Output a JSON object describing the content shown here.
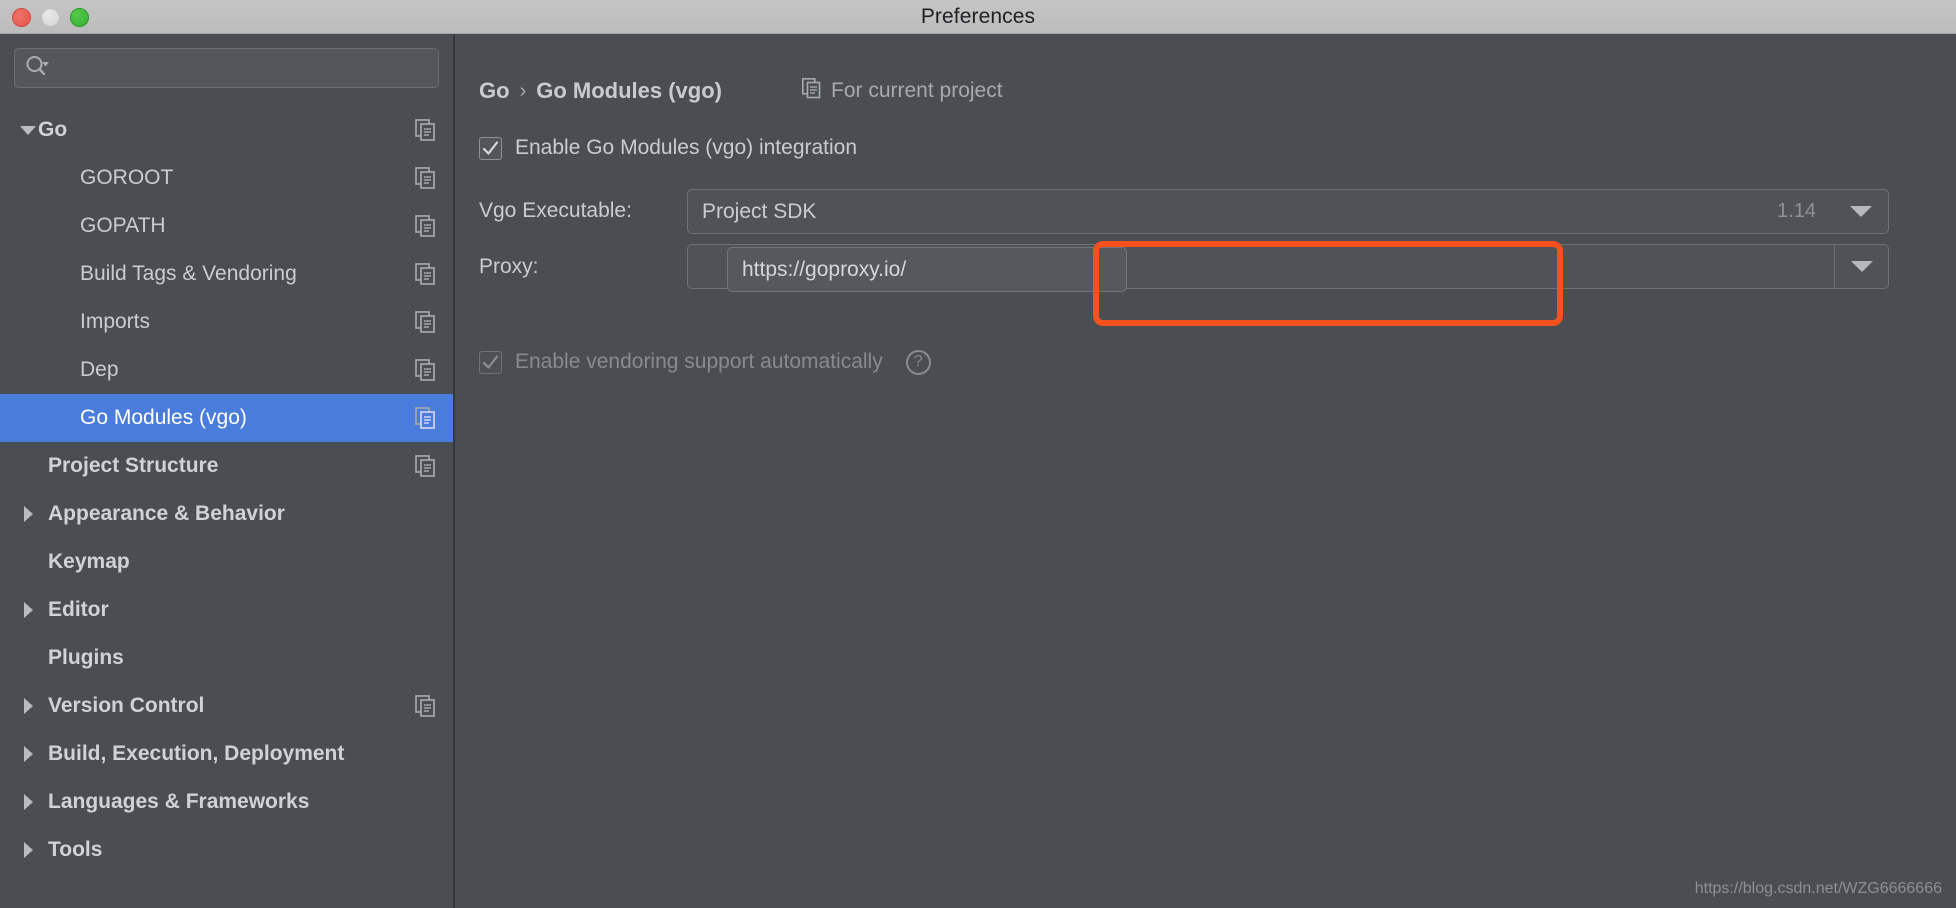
{
  "window": {
    "title": "Preferences",
    "traffic_lights": [
      {
        "name": "close",
        "color": "#e2574c"
      },
      {
        "name": "minimize",
        "color": "#d4d4d4"
      },
      {
        "name": "maximize",
        "color": "#34b033"
      }
    ]
  },
  "sidebar": {
    "search": {
      "value": "",
      "placeholder": "",
      "icon": "search-icon"
    },
    "items": [
      {
        "label": "Go",
        "level": 0,
        "twisty": "down",
        "bold": true,
        "selected": false,
        "copy_icon": true
      },
      {
        "label": "GOROOT",
        "level": 2,
        "twisty": "none",
        "bold": false,
        "selected": false,
        "copy_icon": true
      },
      {
        "label": "GOPATH",
        "level": 2,
        "twisty": "none",
        "bold": false,
        "selected": false,
        "copy_icon": true
      },
      {
        "label": "Build Tags & Vendoring",
        "level": 2,
        "twisty": "none",
        "bold": false,
        "selected": false,
        "copy_icon": true
      },
      {
        "label": "Imports",
        "level": 2,
        "twisty": "none",
        "bold": false,
        "selected": false,
        "copy_icon": true
      },
      {
        "label": "Dep",
        "level": 2,
        "twisty": "none",
        "bold": false,
        "selected": false,
        "copy_icon": true
      },
      {
        "label": "Go Modules (vgo)",
        "level": 2,
        "twisty": "none",
        "bold": false,
        "selected": true,
        "copy_icon": true
      },
      {
        "label": "Project Structure",
        "level": 1,
        "twisty": "none",
        "bold": true,
        "selected": false,
        "copy_icon": true
      },
      {
        "label": "Appearance & Behavior",
        "level": 1,
        "twisty": "right",
        "bold": true,
        "selected": false,
        "copy_icon": false
      },
      {
        "label": "Keymap",
        "level": 1,
        "twisty": "none",
        "bold": true,
        "selected": false,
        "copy_icon": false
      },
      {
        "label": "Editor",
        "level": 1,
        "twisty": "right",
        "bold": true,
        "selected": false,
        "copy_icon": false
      },
      {
        "label": "Plugins",
        "level": 1,
        "twisty": "none",
        "bold": true,
        "selected": false,
        "copy_icon": false
      },
      {
        "label": "Version Control",
        "level": 1,
        "twisty": "right",
        "bold": true,
        "selected": false,
        "copy_icon": true
      },
      {
        "label": "Build, Execution, Deployment",
        "level": 1,
        "twisty": "right",
        "bold": true,
        "selected": false,
        "copy_icon": false
      },
      {
        "label": "Languages & Frameworks",
        "level": 1,
        "twisty": "right",
        "bold": true,
        "selected": false,
        "copy_icon": false
      },
      {
        "label": "Tools",
        "level": 1,
        "twisty": "right",
        "bold": true,
        "selected": false,
        "copy_icon": false
      }
    ],
    "selection_color": "#4a7ddb"
  },
  "main": {
    "breadcrumb": {
      "root": "Go",
      "separator": "›",
      "current": "Go Modules (vgo)"
    },
    "for_current_project": {
      "label": "For current project",
      "icon": "copy-icon"
    },
    "enable_integration": {
      "label": "Enable Go Modules (vgo) integration",
      "checked": true
    },
    "vgo_executable": {
      "label": "Vgo Executable:",
      "value": "Project SDK",
      "version": "1.14",
      "browse_button": "…"
    },
    "proxy": {
      "label": "Proxy:",
      "value": "https://goproxy.io/",
      "help": "?"
    },
    "vendoring": {
      "label": "Enable vendoring support automatically",
      "checked": true,
      "enabled": false,
      "help": "?"
    },
    "annotation": {
      "color": "#f4511e",
      "target": "proxy-field"
    }
  },
  "watermark": {
    "text": "https://blog.csdn.net/WZG6666666"
  }
}
